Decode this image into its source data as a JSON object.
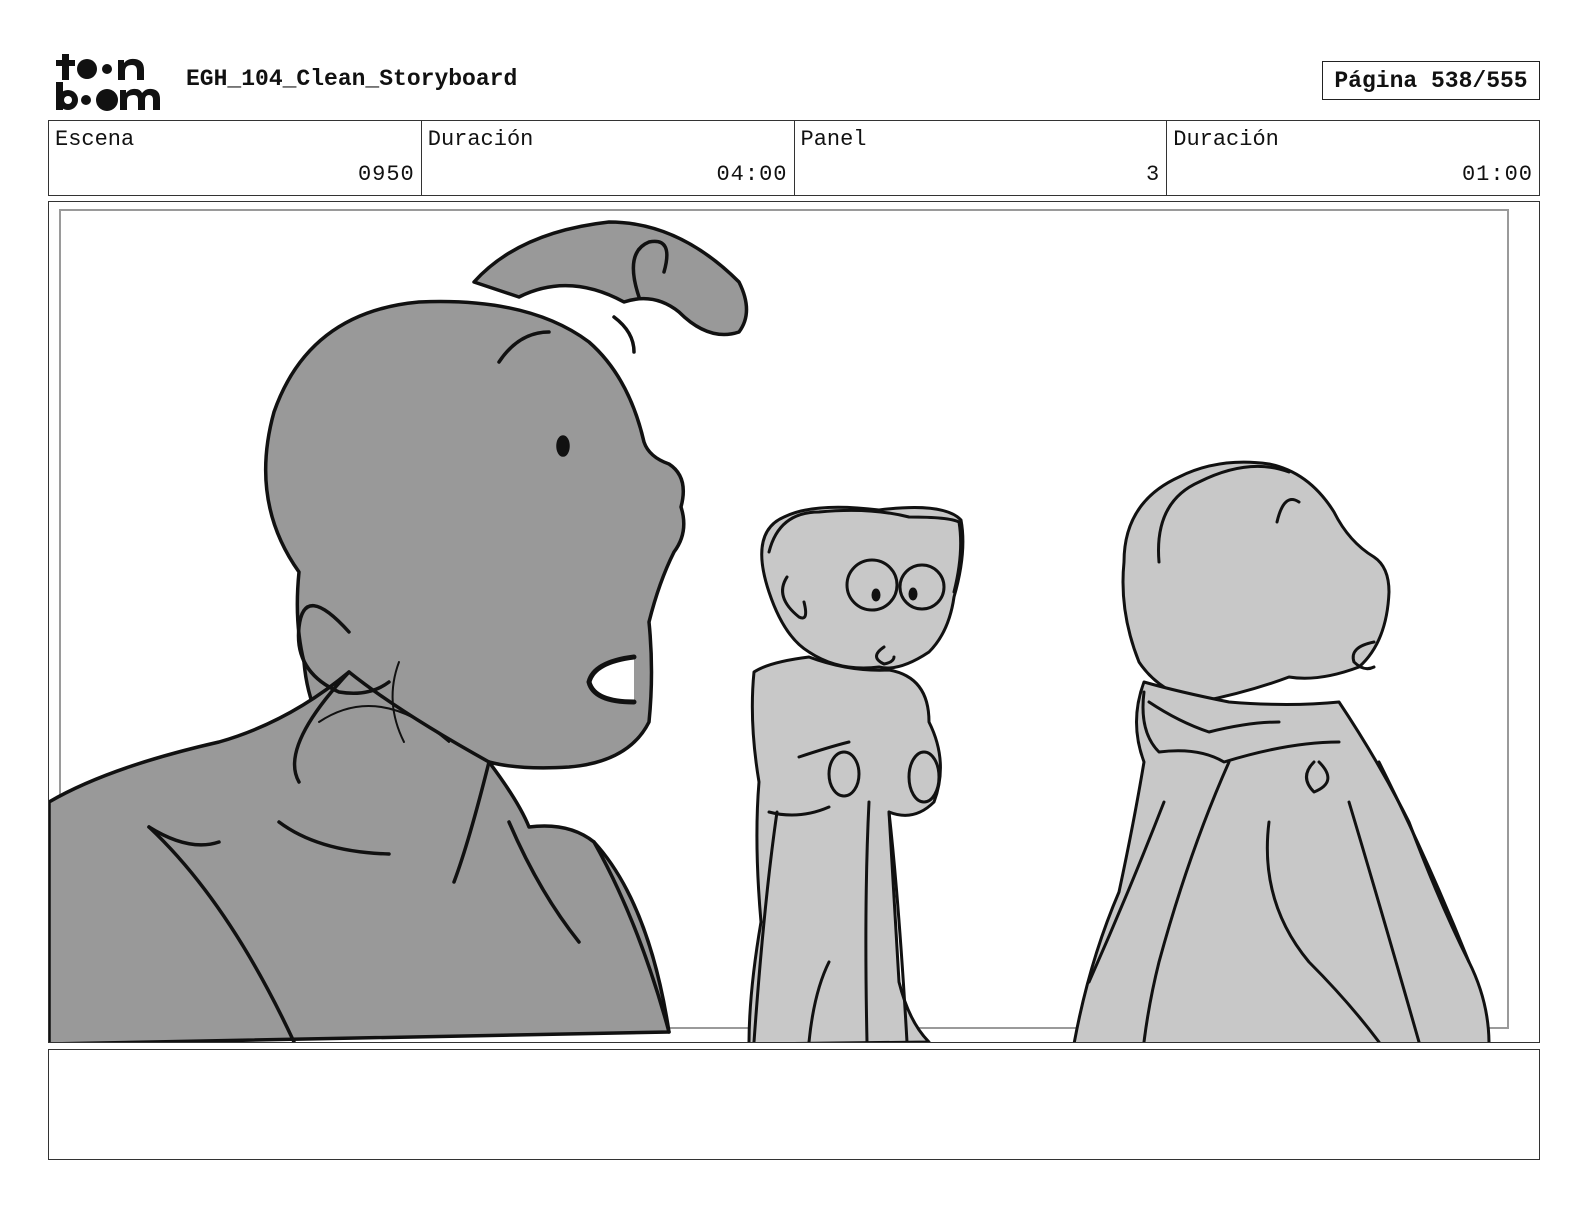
{
  "header": {
    "logo_text": "toon boom",
    "document_title": "EGH_104_Clean_Storyboard",
    "page_indicator": "Página 538/555"
  },
  "info": {
    "scene_label": "Escena",
    "scene_value": "0950",
    "scene_duration_label": "Duración",
    "scene_duration_value": "04:00",
    "panel_label": "Panel",
    "panel_value": "3",
    "panel_duration_label": "Duración",
    "panel_duration_value": "01:00"
  },
  "notes": {
    "text": ""
  }
}
